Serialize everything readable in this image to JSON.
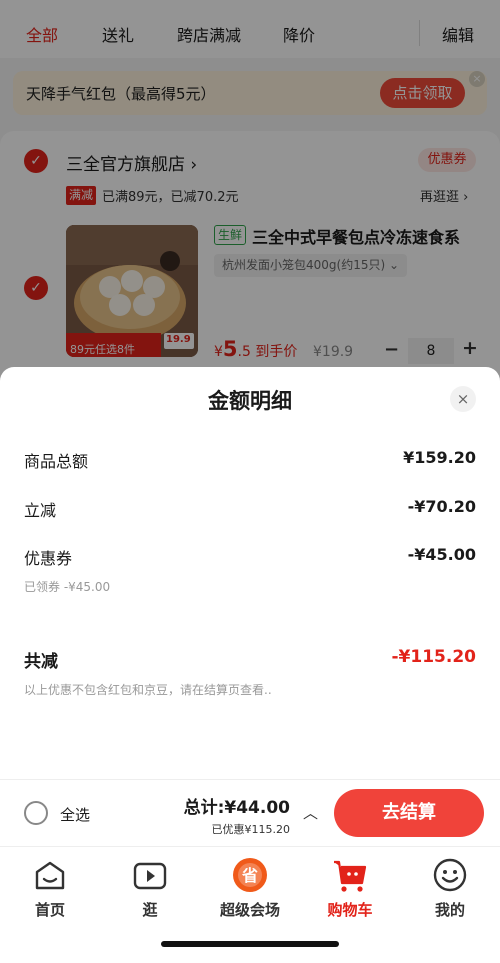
{
  "tabs": [
    {
      "label": "全部",
      "active": true
    },
    {
      "label": "送礼",
      "active": false
    },
    {
      "label": "跨店满减",
      "active": false
    },
    {
      "label": "降价",
      "active": false
    }
  ],
  "edit_label": "编辑",
  "banner": {
    "text": "天降手气红包（最高得5元）",
    "button": "点击领取",
    "close": "×"
  },
  "store": {
    "name": "三全官方旗舰店 ›",
    "coupon_label": "优惠券",
    "promo_tag": "满减",
    "promo_text": "已满89元，已减70.2元",
    "promo_more": "再逛逛 ›"
  },
  "product": {
    "fresh_tag": "生鲜",
    "title": "三全中式早餐包点冷冻速食系",
    "spec": "杭州发面小笼包400g(约15只) ⌄",
    "price_symbol": "¥",
    "price_int": "5",
    "price_dec": ".5",
    "price_suffix": " 到手价",
    "orig_price": "¥19.9",
    "quantity": "8",
    "minus": "−",
    "plus": "+",
    "img_caption": "89元任选8件",
    "img_price": "19.9"
  },
  "sheet": {
    "title": "金额明细",
    "close": "×",
    "rows": [
      {
        "label": "商品总额",
        "value": "¥159.20"
      },
      {
        "label": "立减",
        "value": "-¥70.20"
      },
      {
        "label": "优惠券",
        "value": "-¥45.00",
        "sub": "已领券 -¥45.00"
      }
    ],
    "total_label": "共减",
    "total_value": "-¥115.20",
    "note": "以上优惠不包含红包和京豆，请在结算页查看.."
  },
  "footer": {
    "select_all": "全选",
    "sum_label": "总计:",
    "sum_value": "¥44.00",
    "sum_sub": "已优惠¥115.20",
    "chevron": "︿",
    "checkout": "去结算"
  },
  "tabbar": [
    {
      "label": "首页",
      "icon": "home-icon"
    },
    {
      "label": "逛",
      "icon": "video-icon"
    },
    {
      "label": "超级会场",
      "icon": "super-venue-icon"
    },
    {
      "label": "购物车",
      "icon": "cart-icon",
      "active": true
    },
    {
      "label": "我的",
      "icon": "smiley-icon"
    }
  ],
  "colors": {
    "accent": "#e2231a",
    "checkout": "#f0433a",
    "fresh": "#2fa34a"
  }
}
